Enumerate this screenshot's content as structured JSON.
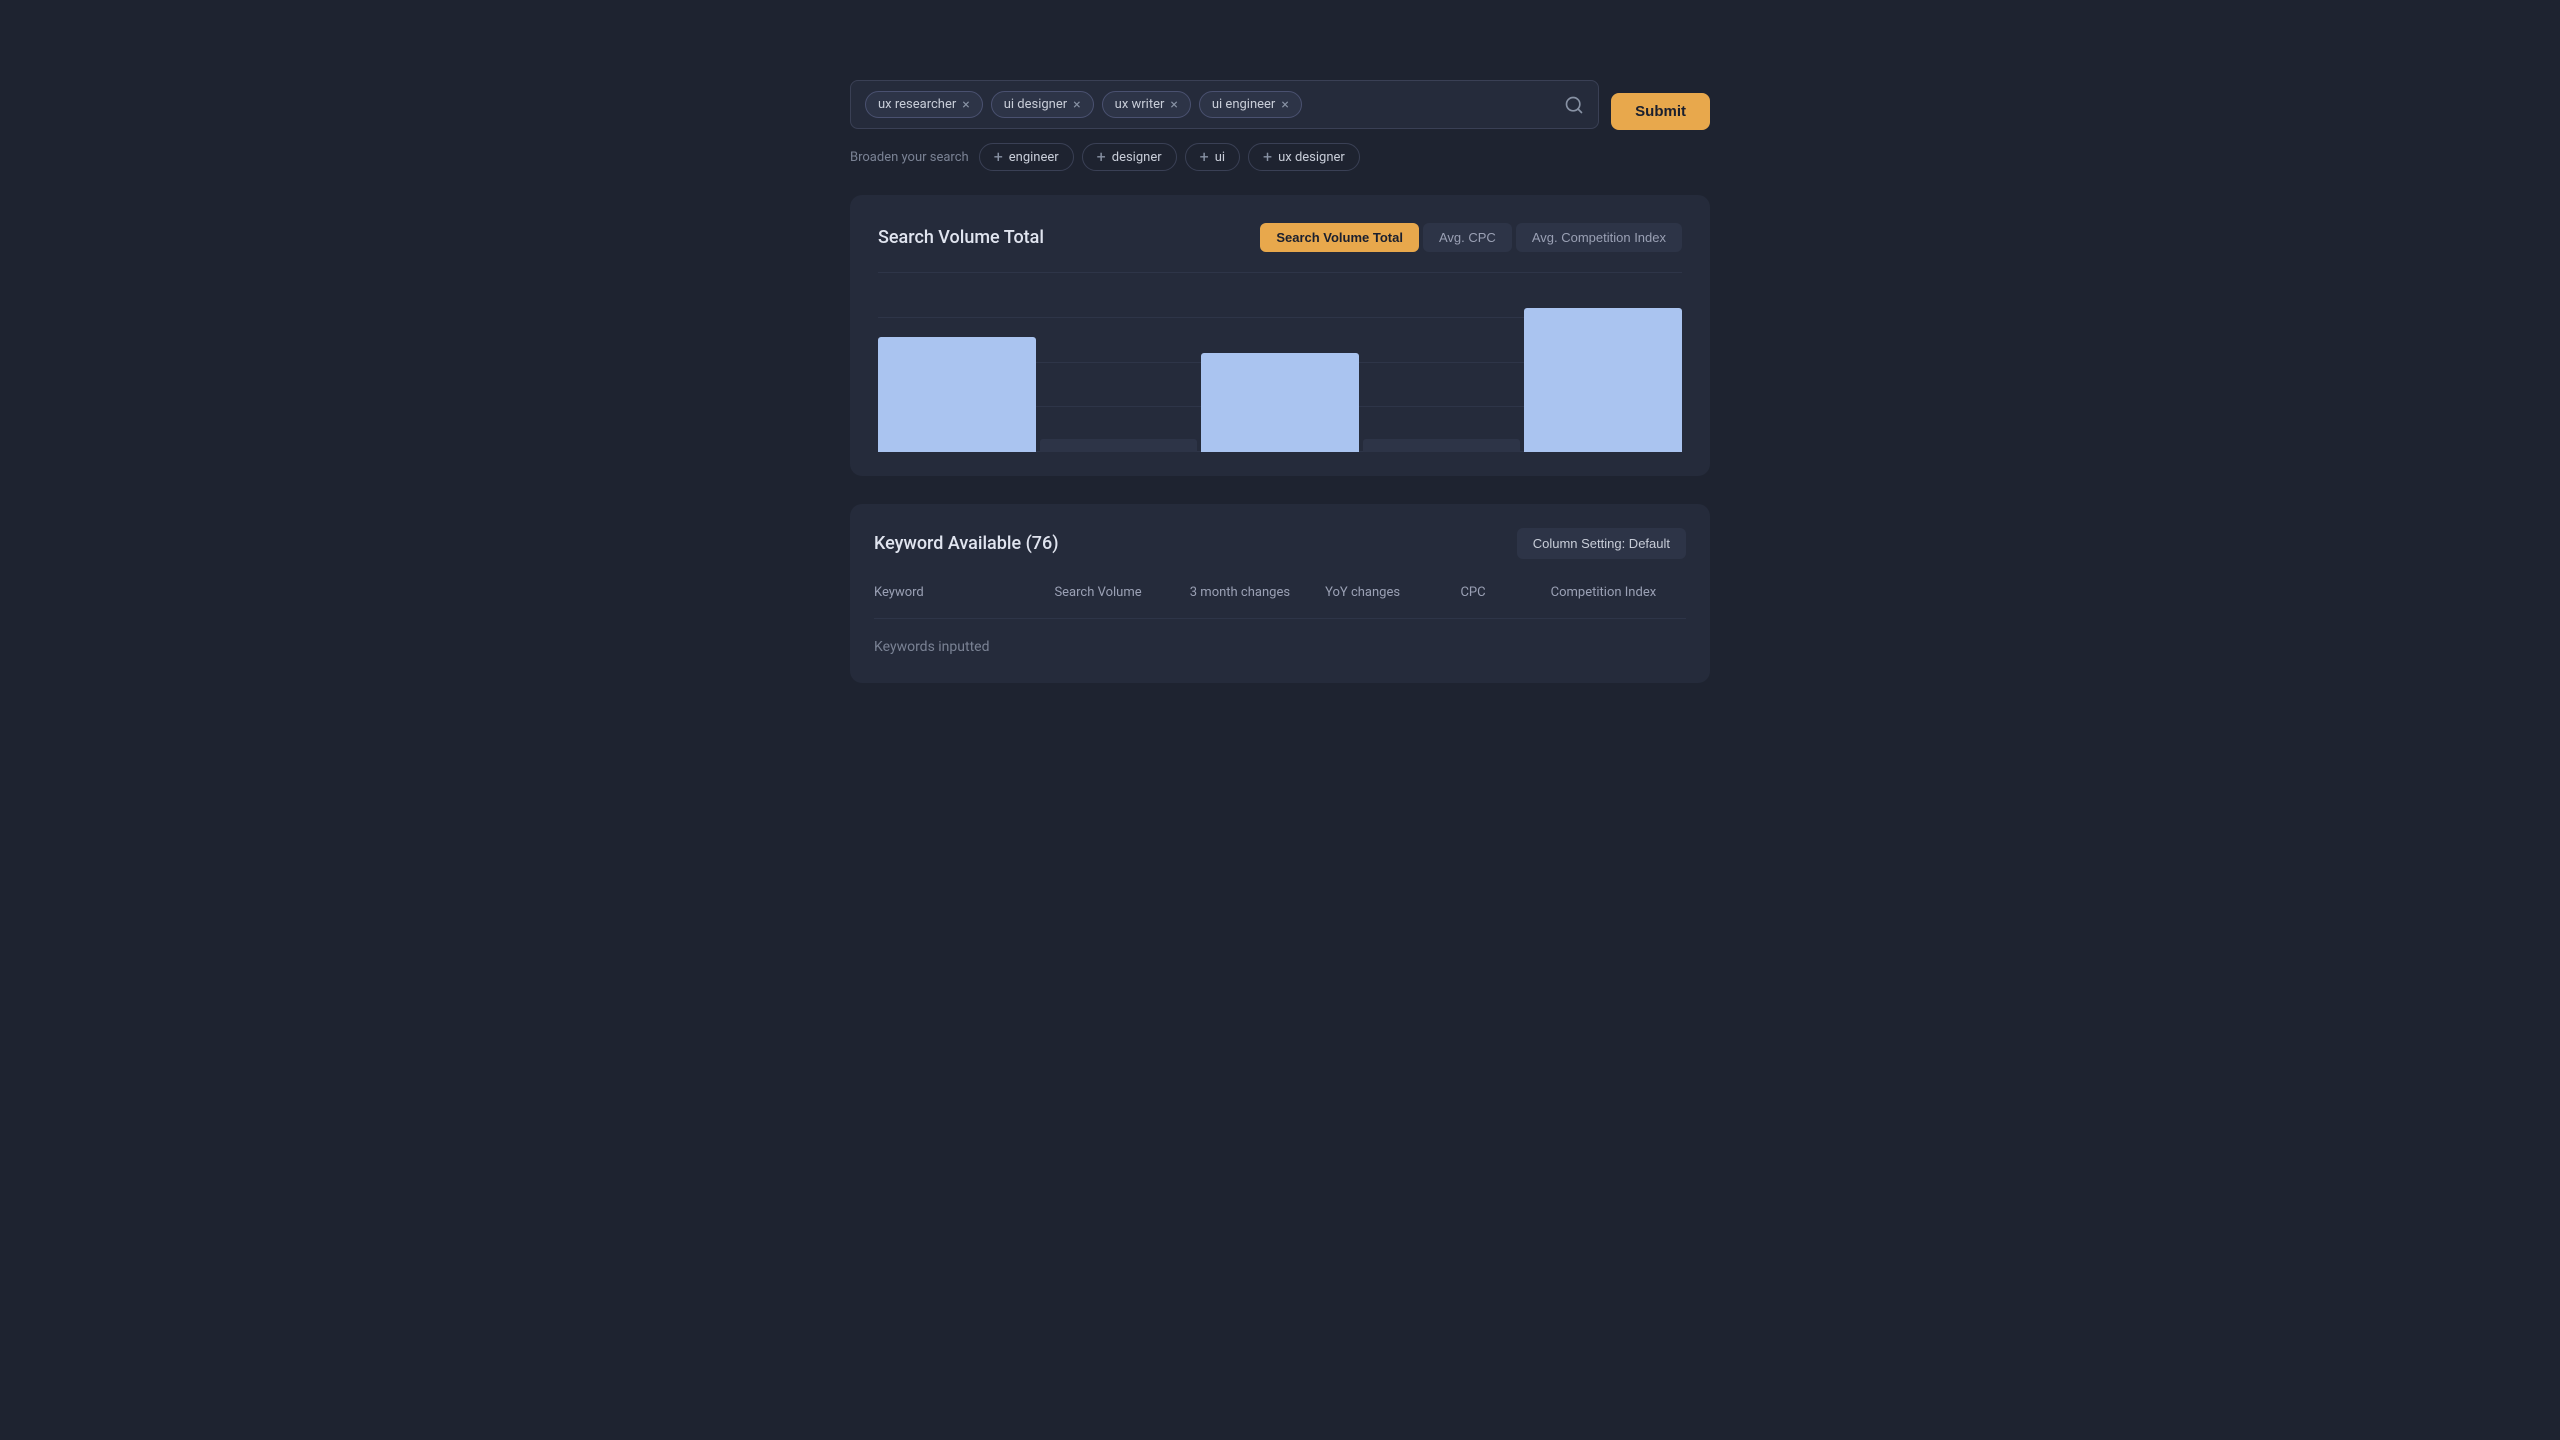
{
  "search": {
    "tags": [
      {
        "id": "tag-ux-researcher",
        "label": "ux researcher"
      },
      {
        "id": "tag-ui-designer",
        "label": "ui designer"
      },
      {
        "id": "tag-ux-writer",
        "label": "ux writer"
      },
      {
        "id": "tag-ui-engineer",
        "label": "ui engineer"
      }
    ],
    "input_placeholder": "",
    "submit_label": "Submit",
    "broaden": {
      "prefix": "Broaden your search",
      "suggestions": [
        {
          "id": "sugg-engineer",
          "label": "engineer"
        },
        {
          "id": "sugg-designer",
          "label": "designer"
        },
        {
          "id": "sugg-ui",
          "label": "ui"
        },
        {
          "id": "sugg-ux-designer",
          "label": "ux designer"
        }
      ]
    }
  },
  "chart": {
    "title": "Search Volume Total",
    "tabs": [
      {
        "id": "tab-search-volume",
        "label": "Search Volume Total",
        "active": true
      },
      {
        "id": "tab-avg-cpc",
        "label": "Avg. CPC",
        "active": false
      },
      {
        "id": "tab-avg-competition",
        "label": "Avg. Competition Index",
        "active": false
      }
    ],
    "bars": [
      {
        "height_pct": 72,
        "color": "#aac4f0"
      },
      {
        "height_pct": 8,
        "color": "#2d3447"
      },
      {
        "height_pct": 62,
        "color": "#aac4f0"
      },
      {
        "height_pct": 8,
        "color": "#2d3447"
      },
      {
        "height_pct": 90,
        "color": "#aac4f0"
      }
    ],
    "grid_lines": 5
  },
  "table": {
    "title": "Keyword Available (76)",
    "column_setting": "Column Setting: Default",
    "columns": [
      {
        "id": "col-keyword",
        "label": "Keyword"
      },
      {
        "id": "col-search-volume",
        "label": "Search Volume"
      },
      {
        "id": "col-3month",
        "label": "3 month changes"
      },
      {
        "id": "col-yoy",
        "label": "YoY changes"
      },
      {
        "id": "col-cpc",
        "label": "CPC"
      },
      {
        "id": "col-competition",
        "label": "Competition Index"
      }
    ],
    "empty_label": "Keywords inputted"
  }
}
